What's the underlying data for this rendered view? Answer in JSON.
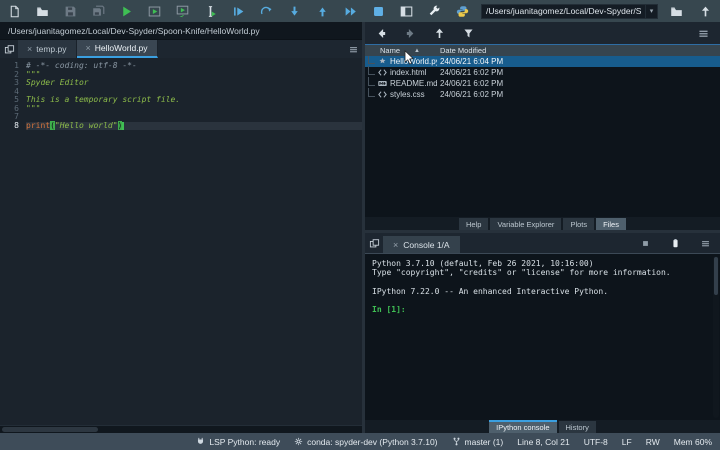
{
  "toolbar": {
    "working_dir": "/Users/juanitagomez/Local/Dev-Spyder/Spoon-Knife",
    "buttons": [
      {
        "name": "new-file"
      },
      {
        "name": "open-file"
      },
      {
        "name": "save-file"
      },
      {
        "name": "save-all"
      },
      {
        "name": "run-file"
      },
      {
        "name": "run-cell"
      },
      {
        "name": "run-cell-advance"
      },
      {
        "name": "run-selection"
      },
      {
        "name": "debug-file"
      },
      {
        "name": "step-over"
      },
      {
        "name": "step-into"
      },
      {
        "name": "step-out"
      },
      {
        "name": "continue-execution"
      },
      {
        "name": "stop-debugging"
      },
      {
        "name": "maximize-pane"
      },
      {
        "name": "preferences"
      },
      {
        "name": "python-path-manager"
      }
    ]
  },
  "editor": {
    "breadcrumb": "/Users/juanitagomez/Local/Dev-Spyder/Spoon-Knife/HelloWorld.py",
    "tabs": [
      {
        "label": "temp.py",
        "active": false
      },
      {
        "label": "HelloWorld.py",
        "active": true
      }
    ],
    "lines": [
      {
        "num": "1",
        "tokens": [
          {
            "text": "# -*- coding: utf-8 -*-",
            "type": "comment"
          }
        ]
      },
      {
        "num": "2",
        "tokens": [
          {
            "text": "\"\"\"",
            "type": "string"
          }
        ]
      },
      {
        "num": "3",
        "tokens": [
          {
            "text": "Spyder Editor",
            "type": "string"
          }
        ]
      },
      {
        "num": "4",
        "tokens": []
      },
      {
        "num": "5",
        "tokens": [
          {
            "text": "This is a temporary script file.",
            "type": "string"
          }
        ]
      },
      {
        "num": "6",
        "tokens": [
          {
            "text": "\"\"\"",
            "type": "string"
          }
        ]
      },
      {
        "num": "7",
        "tokens": []
      },
      {
        "num": "8",
        "current": true,
        "cursor_after": true,
        "tokens": [
          {
            "text": "print",
            "type": "builtin"
          },
          {
            "text": "(",
            "type": "brace-match"
          },
          {
            "text": "\"Hello world\"",
            "type": "string"
          },
          {
            "text": ")",
            "type": "brace-match"
          }
        ]
      }
    ]
  },
  "files": {
    "header": {
      "name": "Name",
      "modified": "Date Modified",
      "sort_indicator": "▲"
    },
    "rows": [
      {
        "name": "HelloWorld.py",
        "modified": "24/06/21 6:04 PM",
        "icon": "python-file",
        "selected": true
      },
      {
        "name": "index.html",
        "modified": "24/06/21 6:02 PM",
        "icon": "code-file",
        "selected": false
      },
      {
        "name": "README.md",
        "modified": "24/06/21 6:02 PM",
        "icon": "markdown-file",
        "selected": false
      },
      {
        "name": "styles.css",
        "modified": "24/06/21 6:02 PM",
        "icon": "code-file",
        "selected": false
      }
    ],
    "tabs": [
      {
        "label": "Help",
        "active": false
      },
      {
        "label": "Variable Explorer",
        "active": false
      },
      {
        "label": "Plots",
        "active": false
      },
      {
        "label": "Files",
        "active": true
      }
    ]
  },
  "console": {
    "tab_label": "Console 1/A",
    "banner": [
      "Python 3.7.10 (default, Feb 26 2021, 10:16:00)",
      "Type \"copyright\", \"credits\" or \"license\" for more information.",
      "",
      "IPython 7.22.0 -- An enhanced Interactive Python.",
      ""
    ],
    "prompt": "In [1]:",
    "tabs": [
      {
        "label": "IPython console",
        "active": true
      },
      {
        "label": "History",
        "active": false
      }
    ]
  },
  "statusbar": {
    "items": [
      {
        "name": "lsp-status",
        "icon": "lsp",
        "text": "LSP Python: ready",
        "interactable": true
      },
      {
        "name": "conda-env",
        "icon": "gear",
        "text": "conda: spyder-dev (Python 3.7.10)",
        "interactable": true
      },
      {
        "name": "git-branch",
        "icon": "branch",
        "text": "master (1)",
        "interactable": true
      },
      {
        "name": "cursor-position",
        "icon": "",
        "text": "Line 8, Col 21",
        "interactable": false
      },
      {
        "name": "encoding",
        "icon": "",
        "text": "UTF-8",
        "interactable": false
      },
      {
        "name": "eol-status",
        "icon": "",
        "text": "LF",
        "interactable": false
      },
      {
        "name": "readwrite-status",
        "icon": "",
        "text": "RW",
        "interactable": false
      },
      {
        "name": "memory-usage",
        "icon": "",
        "text": "Mem 60%",
        "interactable": false
      }
    ]
  },
  "colors": {
    "accent_blue": "#3a9fe0",
    "selection_blue": "#175c8d",
    "run_green": "#3fbf54",
    "debug_blue": "#57ace0",
    "toolbar_bg": "#37474f",
    "editor_bg": "#1b232c",
    "terminal_bg": "#0d141b"
  }
}
